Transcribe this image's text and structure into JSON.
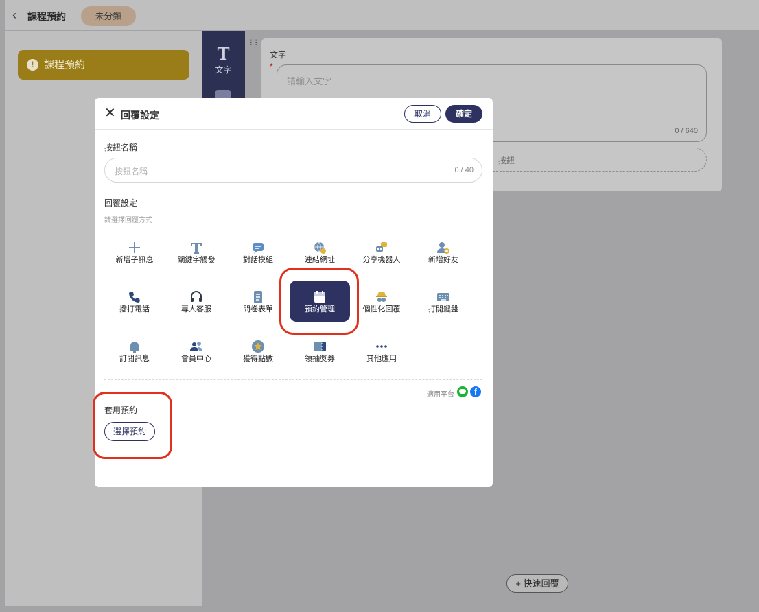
{
  "header": {
    "back_icon": "chevron-left-icon",
    "title": "課程預約",
    "category": "未分類"
  },
  "sidebar": {
    "item_label": "課程預約",
    "item_icon": "warning-icon"
  },
  "tools": {
    "text_label": "文字",
    "text_glyph": "T"
  },
  "editor": {
    "label": "文字",
    "required_mark": "*",
    "placeholder": "請輸入文字",
    "counter": "0 / 640",
    "add_button_partial": "按鈕"
  },
  "quick_reply": {
    "label": "快速回覆",
    "icon": "plus-icon"
  },
  "modal": {
    "title": "回覆設定",
    "cancel_label": "取消",
    "confirm_label": "確定",
    "button_name_label": "按鈕名稱",
    "button_name_placeholder": "按鈕名稱",
    "button_name_counter": "0 / 40",
    "reply_setting_label": "回覆設定",
    "reply_setting_hint": "請選擇回覆方式",
    "options": [
      {
        "label": "新增子訊息",
        "icon": "plus-icon"
      },
      {
        "label": "關鍵字觸發",
        "icon": "text-t-icon"
      },
      {
        "label": "對話模組",
        "icon": "chat-bubble-icon"
      },
      {
        "label": "連結網址",
        "icon": "globe-link-icon"
      },
      {
        "label": "分享機器人",
        "icon": "share-bot-icon"
      },
      {
        "label": "新增好友",
        "icon": "add-friend-icon"
      },
      {
        "label": "撥打電話",
        "icon": "phone-icon"
      },
      {
        "label": "專人客服",
        "icon": "headset-icon"
      },
      {
        "label": "問卷表單",
        "icon": "form-icon"
      },
      {
        "label": "預約管理",
        "icon": "calendar-icon"
      },
      {
        "label": "個性化回覆",
        "icon": "detective-icon"
      },
      {
        "label": "打開鍵盤",
        "icon": "keyboard-icon"
      },
      {
        "label": "訂閱訊息",
        "icon": "bell-icon"
      },
      {
        "label": "會員中心",
        "icon": "members-icon"
      },
      {
        "label": "獲得點數",
        "icon": "star-coin-icon"
      },
      {
        "label": "領抽獎券",
        "icon": "ticket-icon"
      },
      {
        "label": "其他應用",
        "icon": "more-dots-icon"
      }
    ],
    "selected_option": "預約管理",
    "platform_label": "適用平台",
    "platforms": [
      "line-icon",
      "facebook-icon"
    ],
    "apply_booking_label": "套用預約",
    "select_booking_label": "選擇預約"
  },
  "colors": {
    "primary": "#2d3260",
    "highlight": "#e0301e",
    "sidebar_item": "#9a7c18"
  }
}
